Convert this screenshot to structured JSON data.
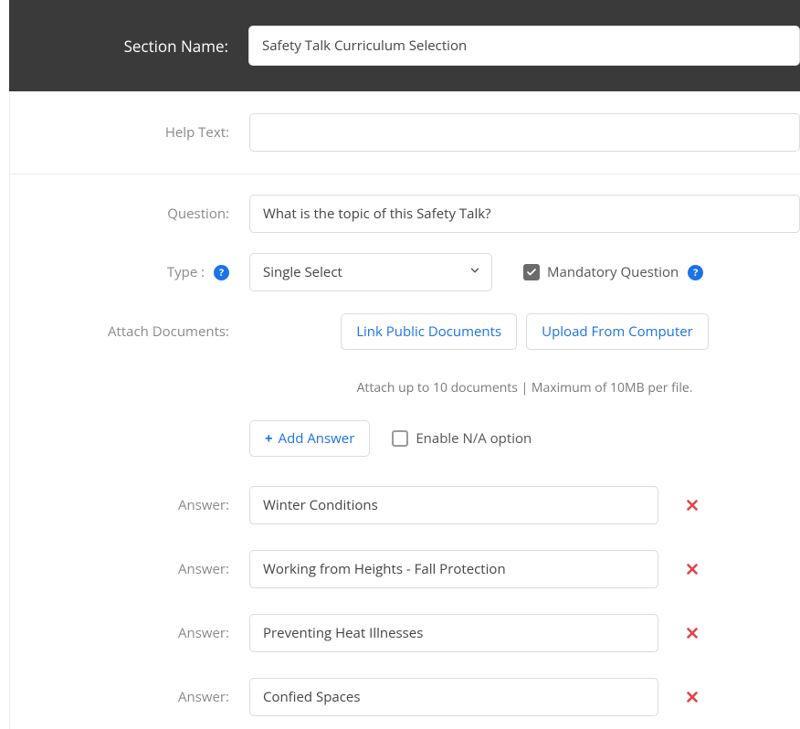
{
  "labels": {
    "section_name": "Section Name:",
    "help_text": "Help Text:",
    "question": "Question:",
    "type": "Type :",
    "attach_documents": "Attach Documents:",
    "answer": "Answer:"
  },
  "header": {
    "section_name_value": "Safety Talk Curriculum Selection"
  },
  "help_text_value": "",
  "question_value": "What is the topic of this Safety Talk?",
  "type_select": {
    "value": "Single Select",
    "options": [
      "Single Select"
    ]
  },
  "mandatory": {
    "label": "Mandatory Question",
    "checked": true
  },
  "attach": {
    "link_public_label": "Link Public Documents",
    "upload_label": "Upload From Computer",
    "helper": "Attach up to 10 documents | Maximum of 10MB per file."
  },
  "add_answer_label": "Add Answer",
  "enable_na": {
    "label": "Enable N/A option",
    "checked": false
  },
  "answers": [
    "Winter Conditions",
    "Working from Heights - Fall Protection",
    "Preventing Heat Illnesses",
    "Confied Spaces"
  ],
  "icons": {
    "help": "?",
    "check": "✓",
    "plus": "+",
    "close": "✕"
  }
}
